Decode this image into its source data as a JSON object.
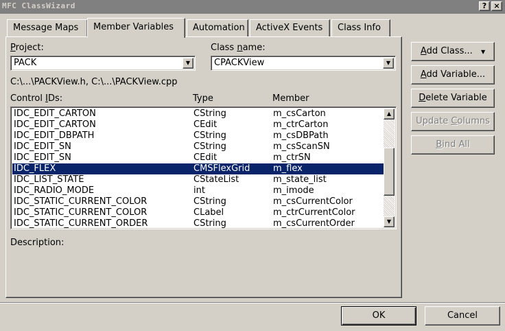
{
  "window": {
    "title": "MFC ClassWizard",
    "help_button": "?",
    "close_button": "×"
  },
  "tabs": [
    {
      "label": "Message Maps"
    },
    {
      "label": "Member Variables"
    },
    {
      "label": "Automation"
    },
    {
      "label": "ActiveX Events"
    },
    {
      "label": "Class Info"
    }
  ],
  "active_tab": "Member Variables",
  "project": {
    "label_prefix": "",
    "label_ul": "P",
    "label_rest": "roject:",
    "value": "PACK"
  },
  "class_name": {
    "label_prefix": "Class ",
    "label_ul": "n",
    "label_rest": "ame:",
    "value": "CPACKView"
  },
  "files_text": "C:\\...\\PACKView.h, C:\\...\\PACKView.cpp",
  "list": {
    "headers": {
      "col1_prefix": "Control ",
      "col1_ul": "I",
      "col1_rest": "Ds:",
      "col2": "Type",
      "col3": "Member"
    },
    "rows": [
      {
        "id": "IDC_EDIT_CARTON",
        "type": "CString",
        "member": "m_csCarton"
      },
      {
        "id": "IDC_EDIT_CARTON",
        "type": "CEdit",
        "member": "m_ctrCarton"
      },
      {
        "id": "IDC_EDIT_DBPATH",
        "type": "CString",
        "member": "m_csDBPath"
      },
      {
        "id": "IDC_EDIT_SN",
        "type": "CString",
        "member": "m_csScanSN"
      },
      {
        "id": "IDC_EDIT_SN",
        "type": "CEdit",
        "member": "m_ctrSN"
      },
      {
        "id": "IDC_FLEX",
        "type": "CMSFlexGrid",
        "member": "m_flex"
      },
      {
        "id": "IDC_LIST_STATE",
        "type": "CStateList",
        "member": "m_state_list"
      },
      {
        "id": "IDC_RADIO_MODE",
        "type": "int",
        "member": "m_imode"
      },
      {
        "id": "IDC_STATIC_CURRENT_COLOR",
        "type": "CString",
        "member": "m_csCurrentColor"
      },
      {
        "id": "IDC_STATIC_CURRENT_COLOR",
        "type": "CLabel",
        "member": "m_ctrCurrentColor"
      },
      {
        "id": "IDC_STATIC_CURRENT_ORDER",
        "type": "CString",
        "member": "m_csCurrentOrder"
      }
    ],
    "selected_index": 5
  },
  "description_label": "Description:",
  "buttons": {
    "add_class": {
      "ul": "A",
      "rest": "dd Class...",
      "arrow": "▼"
    },
    "add_variable": {
      "ul": "A",
      "rest": "dd Variable..."
    },
    "delete_variable": {
      "ul": "D",
      "rest": "elete Variable"
    },
    "update_columns": {
      "prefix": "Update ",
      "ul": "C",
      "rest": "olumns"
    },
    "bind_all": {
      "ul": "B",
      "rest": "ind All"
    },
    "ok": "OK",
    "cancel": "Cancel"
  },
  "colors": {
    "dialog_bg": "#d4d0c8",
    "selection": "#0a246a",
    "titlebar_inactive": "#808080"
  }
}
